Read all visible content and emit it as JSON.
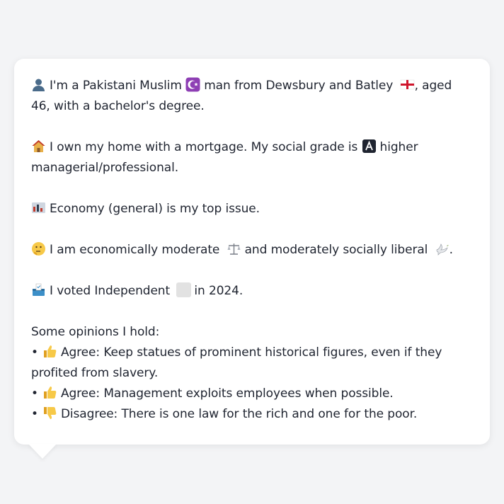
{
  "persona": {
    "intro": {
      "text_a": "I'm a Pakistani Muslim",
      "text_b": "man from Dewsbury and Batley",
      "text_c": ", aged 46, with a bachelor's degree."
    },
    "home": {
      "text_a": "I own my home with a mortgage. My social grade is",
      "text_b": "higher managerial/professional."
    },
    "issue": {
      "text": "Economy (general) is my top issue."
    },
    "ideology": {
      "text_a": "I am economically moderate",
      "text_b": "and moderately socially liberal",
      "text_c": "."
    },
    "vote": {
      "text_a": "I voted Independent",
      "text_b": "in 2024."
    },
    "opinions": {
      "heading": "Some opinions I hold:",
      "items": [
        {
          "bullet": "•",
          "stance": "Agree:",
          "text": "Keep statues of prominent historical figures, even if they profited from slavery.",
          "icon": "thumbs-up-icon"
        },
        {
          "bullet": "•",
          "stance": "Agree:",
          "text": "Management exploits employees when possible.",
          "icon": "thumbs-up-icon"
        },
        {
          "bullet": "•",
          "stance": "Disagree:",
          "text": "There is one law for the rich and one for the poor.",
          "icon": "thumbs-down-icon"
        }
      ]
    }
  },
  "colors": {
    "page_bg": "#f3f4f6",
    "bubble_bg": "#ffffff",
    "text": "#1f2430"
  }
}
